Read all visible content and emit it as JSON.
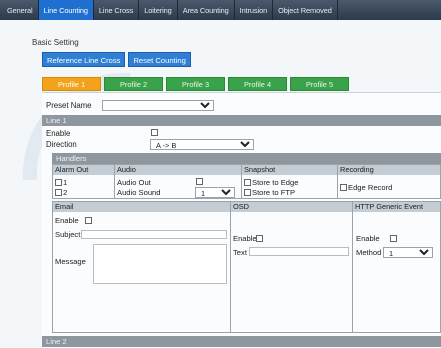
{
  "nav": {
    "tabs": [
      {
        "label": "General"
      },
      {
        "label": "Line Counting"
      },
      {
        "label": "Line Cross"
      },
      {
        "label": "Loitering"
      },
      {
        "label": "Area Counting"
      },
      {
        "label": "Intrusion"
      },
      {
        "label": "Object Removed"
      }
    ],
    "active_index": 1
  },
  "basic_setting": "Basic Setting",
  "buttons": {
    "reference_line_cross": "Reference Line Cross",
    "reset_counting": "Reset Counting"
  },
  "profiles": [
    {
      "label": "Profile 1"
    },
    {
      "label": "Profile 2"
    },
    {
      "label": "Profile 3"
    },
    {
      "label": "Profile 4"
    },
    {
      "label": "Profile 5"
    }
  ],
  "preset": {
    "label": "Preset Name",
    "value": ""
  },
  "line1": {
    "title": "Line 1",
    "enable_label": "Enable",
    "direction_label": "Direction",
    "direction_value": "A -> B"
  },
  "handlers": {
    "title": "Handlers",
    "alarm_out": {
      "header": "Alarm Out",
      "items": [
        "1",
        "2"
      ]
    },
    "audio": {
      "header": "Audio",
      "audio_out": "Audio Out",
      "audio_sound": "Audio Sound",
      "sound_value": "1"
    },
    "snapshot": {
      "header": "Snapshot",
      "store_edge": "Store to Edge",
      "store_ftp": "Store to FTP"
    },
    "recording": {
      "header": "Recording",
      "edge_record": "Edge Record"
    },
    "email": {
      "header": "Email",
      "enable": "Enable",
      "subject": "Subject",
      "message": "Message"
    },
    "osd": {
      "header": "OSD",
      "enable": "Enable",
      "text": "Text"
    },
    "http": {
      "header": "HTTP Generic Event",
      "enable": "Enable",
      "method": "Method",
      "method_value": "1"
    }
  },
  "line2": {
    "title": "Line 2"
  },
  "colors": {
    "nav_active": "#1f6fd1",
    "button_blue": "#2f7fd4",
    "profile_green": "#3aa24a",
    "profile_active": "#f3a31b",
    "section_grey": "#8e969e"
  }
}
